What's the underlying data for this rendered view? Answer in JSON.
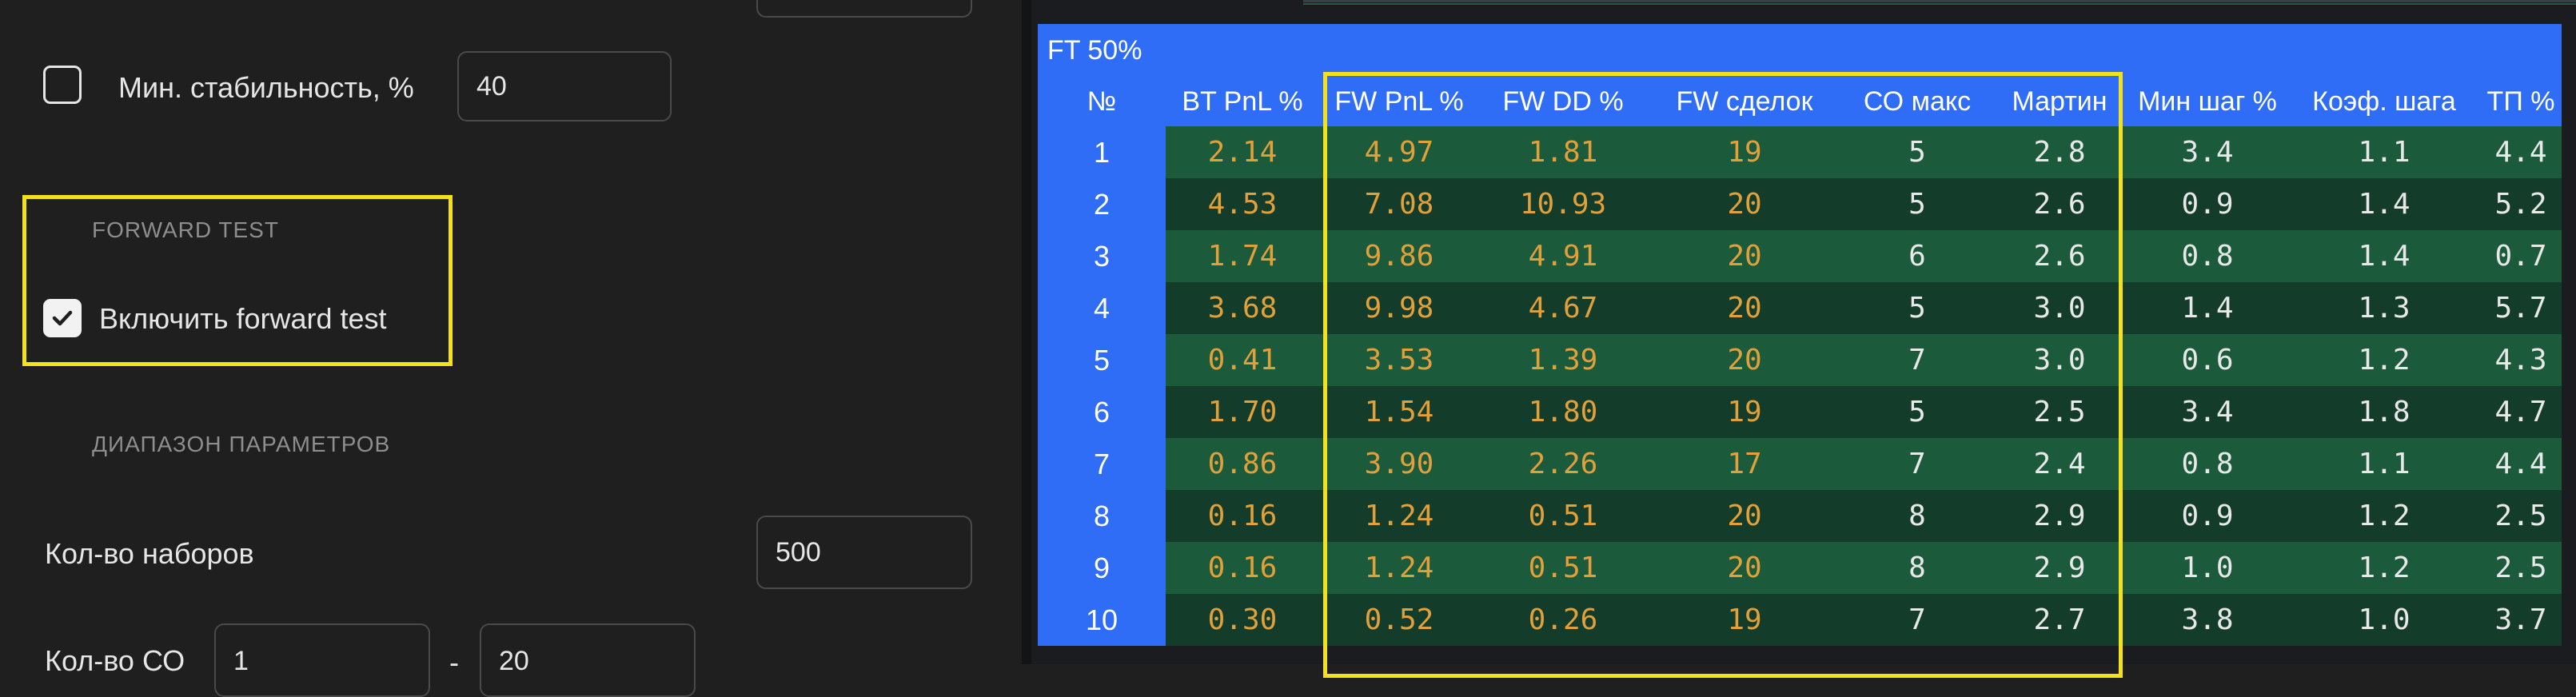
{
  "settings": {
    "min_stability": {
      "label": "Мин. стабильность, %",
      "value": "40",
      "checked": false
    },
    "forward_test": {
      "section": "FORWARD TEST",
      "enable_label": "Включить forward test",
      "checked": true
    },
    "param_range": {
      "section": "ДИАПАЗОН ПАРАМЕТРОВ",
      "sets_label": "Кол-во наборов",
      "sets_value": "500",
      "so_label": "Кол-во СО",
      "so_min": "1",
      "so_sep": "-",
      "so_max": "20"
    }
  },
  "results": {
    "title": "FT 50%",
    "columns": [
      "№",
      "BT PnL %",
      "FW PnL %",
      "FW DD %",
      "FW сделок",
      "СО макс",
      "Мартин",
      "Мин шаг %",
      "Коэф. шага",
      "ТП %"
    ],
    "rows": [
      [
        "1",
        "2.14",
        "4.97",
        "1.81",
        "19",
        "5",
        "2.8",
        "3.4",
        "1.1",
        "4.4"
      ],
      [
        "2",
        "4.53",
        "7.08",
        "10.93",
        "20",
        "5",
        "2.6",
        "0.9",
        "1.4",
        "5.2"
      ],
      [
        "3",
        "1.74",
        "9.86",
        "4.91",
        "20",
        "6",
        "2.6",
        "0.8",
        "1.4",
        "0.7"
      ],
      [
        "4",
        "3.68",
        "9.98",
        "4.67",
        "20",
        "5",
        "3.0",
        "1.4",
        "1.3",
        "5.7"
      ],
      [
        "5",
        "0.41",
        "3.53",
        "1.39",
        "20",
        "7",
        "3.0",
        "0.6",
        "1.2",
        "4.3"
      ],
      [
        "6",
        "1.70",
        "1.54",
        "1.80",
        "19",
        "5",
        "2.5",
        "3.4",
        "1.8",
        "4.7"
      ],
      [
        "7",
        "0.86",
        "3.90",
        "2.26",
        "17",
        "7",
        "2.4",
        "0.8",
        "1.1",
        "4.4"
      ],
      [
        "8",
        "0.16",
        "1.24",
        "0.51",
        "20",
        "8",
        "2.9",
        "0.9",
        "1.2",
        "2.5"
      ],
      [
        "9",
        "0.16",
        "1.24",
        "0.51",
        "20",
        "8",
        "2.9",
        "1.0",
        "1.2",
        "2.5"
      ],
      [
        "10",
        "0.30",
        "0.52",
        "0.26",
        "19",
        "7",
        "2.7",
        "3.8",
        "1.0",
        "3.7"
      ]
    ]
  },
  "colors": {
    "table_header": "#2f6df6",
    "row_light": "#1c5a3c",
    "row_dark": "#133d2a",
    "orange_value": "#e2a03a",
    "highlight": "#f4e11a"
  }
}
